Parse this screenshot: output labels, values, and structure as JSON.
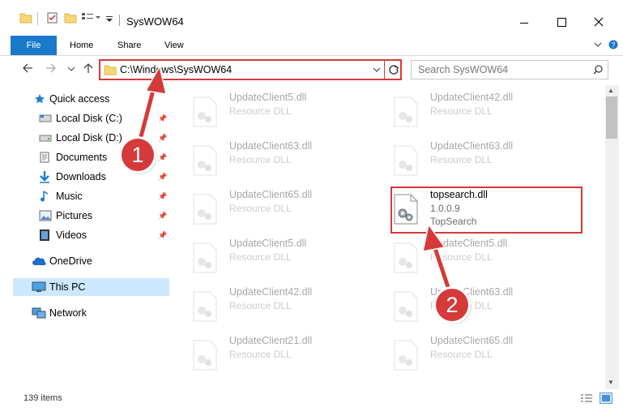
{
  "window": {
    "title": "SysWOW64",
    "controls": [
      "minimize",
      "maximize",
      "close"
    ]
  },
  "ribbon": {
    "tabs": [
      {
        "label": "File"
      },
      {
        "label": "Home"
      },
      {
        "label": "Share"
      },
      {
        "label": "View"
      }
    ]
  },
  "address": {
    "path": "C:\\Windows\\SysWOW64",
    "refresh_icon": "refresh-icon"
  },
  "search": {
    "placeholder": "Search SysWOW64",
    "icon": "search-icon"
  },
  "nav": {
    "items": [
      {
        "label": "Quick access",
        "icon": "star-icon",
        "pinned": false
      },
      {
        "label": "Local Disk (C:)",
        "icon": "drive-icon",
        "pinned": true
      },
      {
        "label": "Local Disk (D:)",
        "icon": "drive-icon",
        "pinned": true
      },
      {
        "label": "Documents",
        "icon": "documents-icon",
        "pinned": true
      },
      {
        "label": "Downloads",
        "icon": "downloads-icon",
        "pinned": true
      },
      {
        "label": "Music",
        "icon": "music-icon",
        "pinned": true
      },
      {
        "label": "Pictures",
        "icon": "pictures-icon",
        "pinned": true
      },
      {
        "label": "Videos",
        "icon": "videos-icon",
        "pinned": true
      },
      {
        "label": "OneDrive",
        "icon": "cloud-icon",
        "pinned": false
      },
      {
        "label": "This PC",
        "icon": "computer-icon",
        "pinned": false,
        "selected": true
      },
      {
        "label": "Network",
        "icon": "network-icon",
        "pinned": false
      }
    ]
  },
  "files": [
    {
      "name": "UpdateClient5.dll",
      "desc": "Resource DLL"
    },
    {
      "name": "UpdateClient42.dll",
      "desc": "Resource DLL"
    },
    {
      "name": "UpdateClient63.dll",
      "desc": "Resource DLL"
    },
    {
      "name": "UpdateClient63.dll",
      "desc": "Resource DLL"
    },
    {
      "name": "UpdateClient65.dll",
      "desc": "Resource DLL"
    },
    {
      "name": "topsearch.dll",
      "version": "1.0.0.9",
      "desc": "TopSearch",
      "highlighted": true
    },
    {
      "name": "UpdateClient5.dll",
      "desc": "Resource DLL"
    },
    {
      "name": "UpdateClient5.dll",
      "desc": "Resource DLL"
    },
    {
      "name": "UpdateClient42.dll",
      "desc": "Resource DLL"
    },
    {
      "name": "UpdateClient63.dll",
      "desc": "Resource DLL"
    },
    {
      "name": "UpdateClient21.dll",
      "desc": "Resource DLL"
    },
    {
      "name": "UpdateClient65.dll",
      "desc": "Resource DLL"
    }
  ],
  "status": {
    "item_count": "139 items"
  },
  "callouts": [
    {
      "number": "1"
    },
    {
      "number": "2"
    }
  ],
  "colors": {
    "accent": "#1979ca",
    "highlight_red": "#d43a3a",
    "selection": "#cce8ff"
  }
}
